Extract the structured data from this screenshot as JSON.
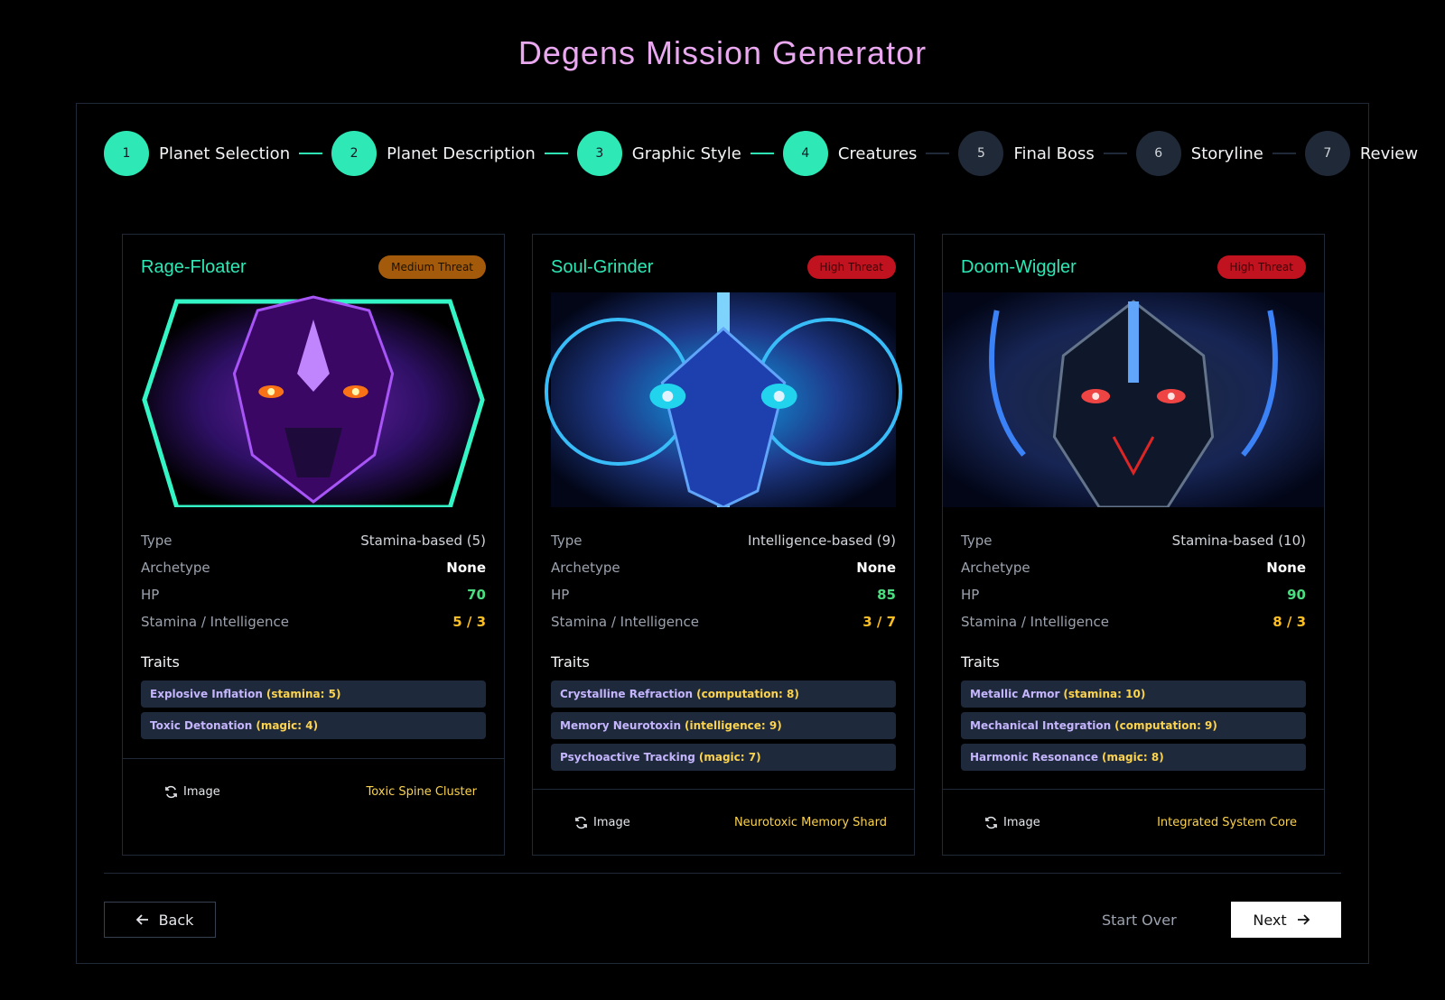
{
  "title": "Degens Mission Generator",
  "colors": {
    "accent": "#2ee8b6",
    "title": "#e9a8ef",
    "medium_threat": "#a35a0b",
    "high_threat": "#c1121f"
  },
  "steps": [
    {
      "num": "1",
      "label": "Planet Selection",
      "done": true
    },
    {
      "num": "2",
      "label": "Planet Description",
      "done": true
    },
    {
      "num": "3",
      "label": "Graphic Style",
      "done": true
    },
    {
      "num": "4",
      "label": "Creatures",
      "done": true
    },
    {
      "num": "5",
      "label": "Final Boss",
      "done": false
    },
    {
      "num": "6",
      "label": "Storyline",
      "done": false
    },
    {
      "num": "7",
      "label": "Review",
      "done": false
    }
  ],
  "cards": [
    {
      "name": "Rage-Floater",
      "threat": "Medium Threat",
      "image_icon": "purple-creature-portrait",
      "type_label": "Type",
      "type_value": "Stamina-based (5)",
      "archetype_label": "Archetype",
      "archetype_value": "None",
      "hp_label": "HP",
      "hp_value": "70",
      "si_label": "Stamina / Intelligence",
      "si_value": "5 / 3",
      "traits_title": "Traits",
      "traits": [
        {
          "name": "Explosive Inflation",
          "stat": "(stamina: 5)"
        },
        {
          "name": "Toxic Detonation",
          "stat": "(magic: 4)"
        }
      ],
      "image_btn": "Image",
      "loot": "Toxic Spine Cluster"
    },
    {
      "name": "Soul-Grinder",
      "threat": "High Threat",
      "image_icon": "blue-creature-portrait",
      "type_label": "Type",
      "type_value": "Intelligence-based (9)",
      "archetype_label": "Archetype",
      "archetype_value": "None",
      "hp_label": "HP",
      "hp_value": "85",
      "si_label": "Stamina / Intelligence",
      "si_value": "3 / 7",
      "traits_title": "Traits",
      "traits": [
        {
          "name": "Crystalline Refraction",
          "stat": "(computation: 8)"
        },
        {
          "name": "Memory Neurotoxin",
          "stat": "(intelligence: 9)"
        },
        {
          "name": "Psychoactive Tracking",
          "stat": "(magic: 7)"
        }
      ],
      "image_btn": "Image",
      "loot": "Neurotoxic Memory Shard"
    },
    {
      "name": "Doom-Wiggler",
      "threat": "High Threat",
      "image_icon": "red-eyed-creature-portrait",
      "type_label": "Type",
      "type_value": "Stamina-based (10)",
      "archetype_label": "Archetype",
      "archetype_value": "None",
      "hp_label": "HP",
      "hp_value": "90",
      "si_label": "Stamina / Intelligence",
      "si_value": "8 / 3",
      "traits_title": "Traits",
      "traits": [
        {
          "name": "Metallic Armor",
          "stat": "(stamina: 10)"
        },
        {
          "name": "Mechanical Integration",
          "stat": "(computation: 9)"
        },
        {
          "name": "Harmonic Resonance",
          "stat": "(magic: 8)"
        }
      ],
      "image_btn": "Image",
      "loot": "Integrated System Core"
    }
  ],
  "nav": {
    "back": "Back",
    "start_over": "Start Over",
    "next": "Next"
  }
}
